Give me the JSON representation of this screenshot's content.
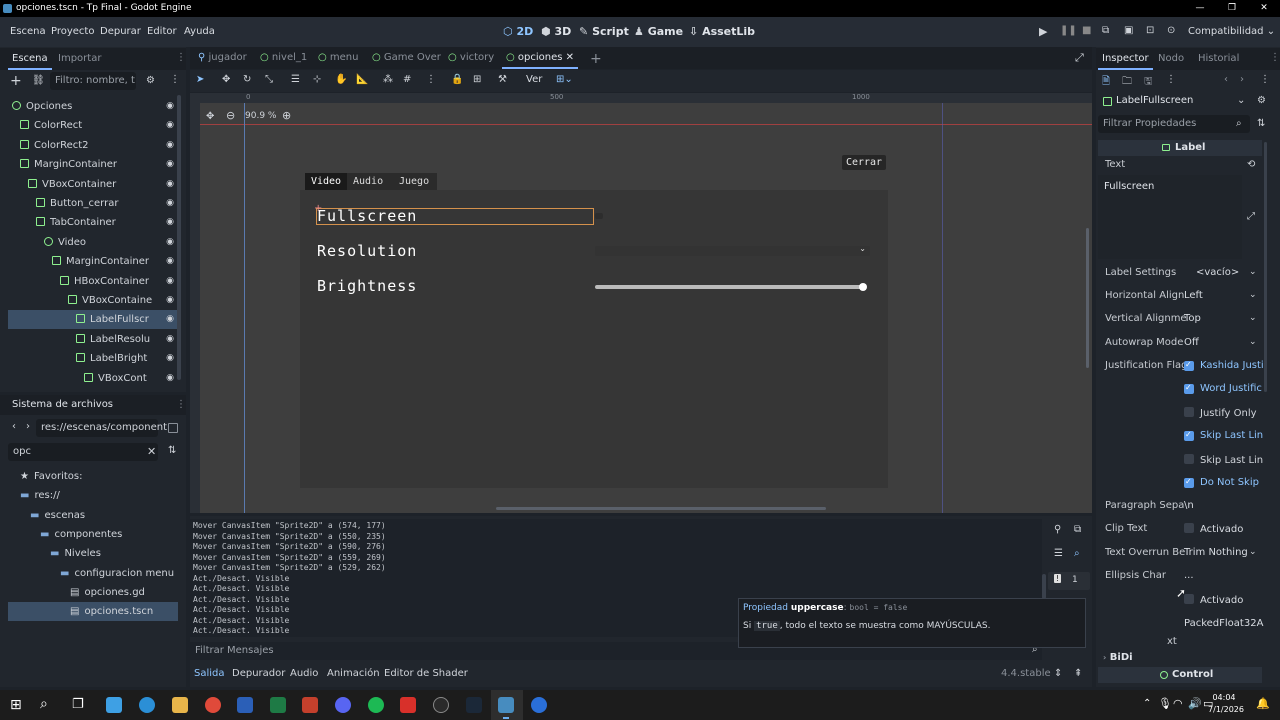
{
  "window": {
    "title": "opciones.tscn - Tp Final - Godot Engine",
    "controls": [
      "—",
      "❐",
      "✕"
    ]
  },
  "menu": {
    "items": [
      "Escena",
      "Proyecto",
      "Depurar",
      "Editor",
      "Ayuda"
    ],
    "workspaces": [
      "2D",
      "3D",
      "Script",
      "Game",
      "AssetLib"
    ],
    "renderer": "Compatibilidad"
  },
  "scene_dock": {
    "tabs": [
      "Escena",
      "Importar"
    ],
    "filter_placeholder": "Filtro: nombre, t",
    "nodes": [
      {
        "label": "Opciones",
        "indent": 0
      },
      {
        "label": "ColorRect",
        "indent": 1
      },
      {
        "label": "ColorRect2",
        "indent": 1
      },
      {
        "label": "MarginContainer",
        "indent": 1
      },
      {
        "label": "VBoxContainer",
        "indent": 2
      },
      {
        "label": "Button_cerrar",
        "indent": 3
      },
      {
        "label": "TabContainer",
        "indent": 3
      },
      {
        "label": "Video",
        "indent": 4
      },
      {
        "label": "MarginContainer",
        "indent": 5
      },
      {
        "label": "HBoxContainer",
        "indent": 6
      },
      {
        "label": "VBoxContaine",
        "indent": 7
      },
      {
        "label": "LabelFullscr",
        "indent": 8
      },
      {
        "label": "LabelResolu",
        "indent": 8
      },
      {
        "label": "LabelBright",
        "indent": 8
      },
      {
        "label": "VBoxCont",
        "indent": 9
      }
    ]
  },
  "filesystem": {
    "title": "Sistema de archivos",
    "path": "res://escenas/component",
    "search": "opc",
    "items": [
      {
        "label": "Favoritos:",
        "indent": 0
      },
      {
        "label": "res://",
        "indent": 0
      },
      {
        "label": "escenas",
        "indent": 1
      },
      {
        "label": "componentes",
        "indent": 2
      },
      {
        "label": "Niveles",
        "indent": 3
      },
      {
        "label": "configuracion menu",
        "indent": 4
      },
      {
        "label": "opciones.gd",
        "indent": 5
      },
      {
        "label": "opciones.tscn",
        "indent": 5
      }
    ]
  },
  "editor_tabs": [
    "jugador",
    "nivel_1",
    "menu",
    "Game Over",
    "victory",
    "opciones"
  ],
  "toolbar": {
    "view_label": "Ver"
  },
  "viewport": {
    "zoom": "90.9 %",
    "ruler_marks": [
      "0",
      "500",
      "1000"
    ],
    "tabs": [
      "Video",
      "Audio",
      "Juego"
    ],
    "close_button": "Cerrar",
    "labels": [
      "Fullscreen",
      "Resolution",
      "Brightness"
    ],
    "brightness_value": 1.0
  },
  "output": {
    "lines": [
      "Mover CanvasItem \"Sprite2D\" a (574, 177)",
      "Mover CanvasItem \"Sprite2D\" a (550, 235)",
      "Mover CanvasItem \"Sprite2D\" a (590, 276)",
      "Mover CanvasItem \"Sprite2D\" a (559, 269)",
      "Mover CanvasItem \"Sprite2D\" a (529, 262)",
      "Act./Desact. Visible",
      "Act./Desact. Visible",
      "Act./Desact. Visible",
      "Act./Desact. Visible",
      "Act./Desact. Visible",
      "Act./Desact. Visible"
    ],
    "filter_placeholder": "Filtrar Mensajes",
    "error_count": "1",
    "bottom_tabs": [
      "Salida",
      "Depurador",
      "Audio",
      "Animación",
      "Editor de Shader"
    ],
    "version": "4.4.stable"
  },
  "tooltip": {
    "prefix": "Propiedad",
    "name": "uppercase",
    "type": "bool = false",
    "line_a": "Si",
    "code": "true",
    "line_b": ", todo el texto se muestra como MAYÚSCULAS."
  },
  "inspector": {
    "tabs": [
      "Inspector",
      "Nodo",
      "Historial"
    ],
    "node_name": "LabelFullscreen",
    "filter_placeholder": "Filtrar Propiedades",
    "class": "Label",
    "text_label": "Text",
    "text_value": "Fullscreen",
    "label_settings": {
      "label": "Label Settings",
      "value": "<vacío>"
    },
    "horizontal": {
      "label": "Horizontal Align",
      "value": "Left"
    },
    "vertical": {
      "label": "Vertical Alignme",
      "value": "Top"
    },
    "autowrap": {
      "label": "Autowrap Mode",
      "value": "Off"
    },
    "justification": {
      "label": "Justification Flag",
      "flags": [
        {
          "label": "Kashida Justi",
          "on": true
        },
        {
          "label": "Word Justific",
          "on": true
        },
        {
          "label": "Justify Only",
          "on": false
        },
        {
          "label": "Skip Last Lin",
          "on": true
        },
        {
          "label": "Skip Last Lin",
          "on": false
        },
        {
          "label": "Do Not Skip",
          "on": true
        }
      ]
    },
    "paragraph": {
      "label": "Paragraph Sepa",
      "value": "\\n"
    },
    "clip_text": {
      "label": "Clip Text",
      "value": "Activado"
    },
    "overrun": {
      "label": "Text Overrun Be",
      "value": "Trim Nothing"
    },
    "ellipsis": {
      "label": "Ellipsis Char",
      "value": "..."
    },
    "uppercase_value": "Activado",
    "tab_stops": "PackedFloat32A",
    "partial_label": "xt",
    "bidi": "BiDi",
    "control": "Control"
  },
  "clock": {
    "time": "04:04",
    "date": "7/1/2026"
  },
  "colors": {
    "accent": "#7fb1ff",
    "node_green": "#8ef08f",
    "selected": "#3b4f66",
    "panel_bg": "#363636",
    "focus_orange": "#d4914c"
  }
}
